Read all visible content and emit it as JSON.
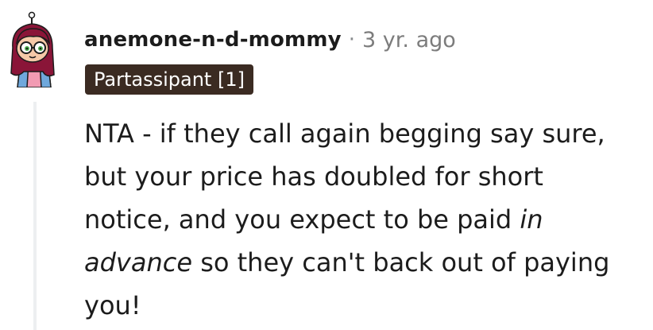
{
  "comment": {
    "author": "anemone-n-d-mommy",
    "separator": "·",
    "time_ago": "3 yr. ago",
    "flair": "Partassipant [1]",
    "body": {
      "part1": "NTA - if they call again begging say sure, but your price has doubled for short notice, and you expect to be paid ",
      "italic1": "in",
      "space": " ",
      "italic2": "advance",
      "part2": " so they can't back out of paying you!"
    },
    "avatar_icon": "snoo-avatar-icon"
  },
  "colors": {
    "text": "#1c1c1c",
    "muted": "#7c7c7c",
    "flair_bg": "#3b2b22",
    "flair_text": "#ffffff",
    "thread_line": "#edeff1",
    "avatar_hair": "#8a1538"
  }
}
